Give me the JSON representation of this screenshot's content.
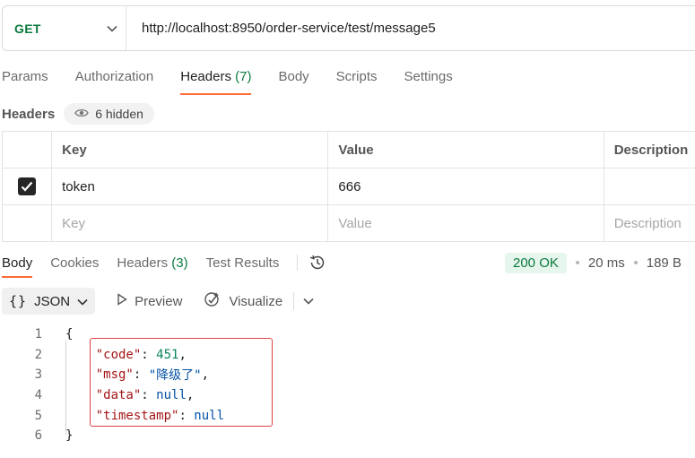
{
  "request": {
    "method": "GET",
    "url": "http://localhost:8950/order-service/test/message5"
  },
  "request_tabs": [
    {
      "label": "Params"
    },
    {
      "label": "Authorization"
    },
    {
      "label": "Headers",
      "count": "(7)"
    },
    {
      "label": "Body"
    },
    {
      "label": "Scripts"
    },
    {
      "label": "Settings"
    }
  ],
  "headers_section": {
    "label": "Headers",
    "hidden_label": "6 hidden"
  },
  "headers_table": {
    "columns": [
      "Key",
      "Value",
      "Description"
    ],
    "rows": [
      {
        "checked": true,
        "key": "token",
        "value": "666",
        "description": ""
      }
    ],
    "placeholders": {
      "key": "Key",
      "value": "Value",
      "description": "Description"
    }
  },
  "response_tabs": [
    {
      "label": "Body"
    },
    {
      "label": "Cookies"
    },
    {
      "label": "Headers",
      "count": "(3)"
    },
    {
      "label": "Test Results"
    }
  ],
  "response_status": {
    "status": "200 OK",
    "time": "20 ms",
    "size": "189 B"
  },
  "body_toolbar": {
    "format": "JSON",
    "preview_label": "Preview",
    "visualize_label": "Visualize"
  },
  "response_body": {
    "line_numbers": [
      "1",
      "2",
      "3",
      "4",
      "5",
      "6"
    ],
    "open_brace": "{",
    "close_brace": "}",
    "fields": [
      {
        "key": "\"code\"",
        "value": "451",
        "kind": "num",
        "comma": ","
      },
      {
        "key": "\"msg\"",
        "value": "\"降级了\"",
        "kind": "str",
        "comma": ","
      },
      {
        "key": "\"data\"",
        "value": "null",
        "kind": "kw",
        "comma": ","
      },
      {
        "key": "\"timestamp\"",
        "value": "null",
        "kind": "kw",
        "comma": ""
      }
    ]
  },
  "colors": {
    "accent": "#ff6c37",
    "method_green": "#0b7a3e",
    "highlight_red": "#e04444"
  }
}
